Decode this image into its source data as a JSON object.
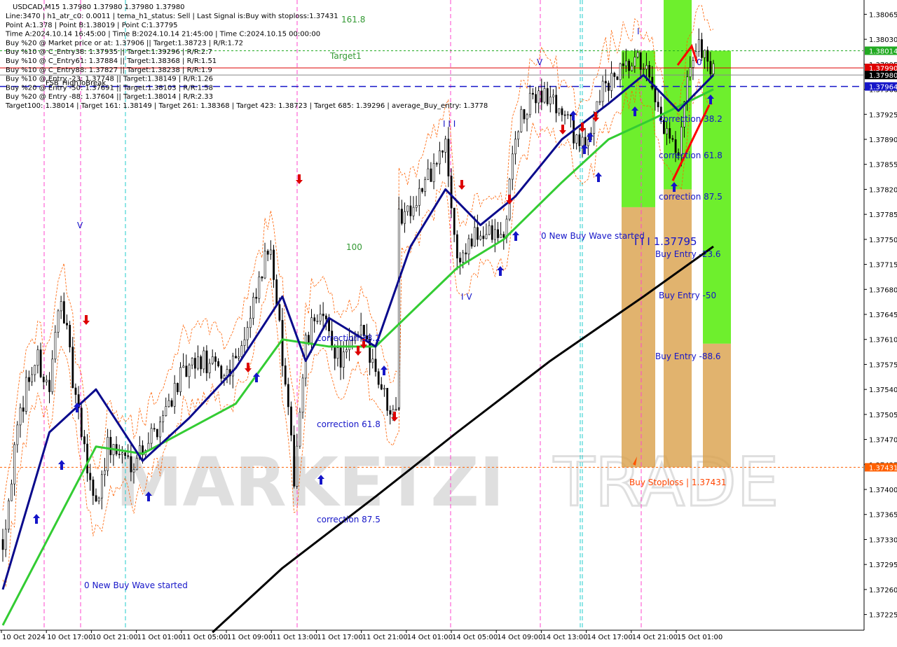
{
  "header": {
    "symbol_line": "USDCAD,M15   1.37980 1.37980 1.37980 1.37980",
    "lines": [
      "Line:3470 | h1_atr_c0: 0.0011 | tema_h1_status: Sell | Last Signal is:Buy with stoploss:1.37431",
      "Point A:1.378 | Point B:1.38019 | Point C:1.37795",
      "Time A:2024.10.14 16:45:00 | Time B:2024.10.14 21:45:00 | Time C:2024.10.15 00:00:00",
      "Buy %20 @ Market price or at: 1.37906 || Target:1.38723 | R/R:1.72",
      "Buy %10 @ C_Entry38: 1.37935 || Target:1.39296 | R/R:2.7",
      "Buy %10 @ C_Entry61: 1.37884 || Target:1.38368 | R/R:1.51",
      "Buy %10 @ C_Entry88: 1.37827 || Target:1.38238 | R/R:1.9",
      "Buy %10 @ Entry -23: 1.37748 || Target:1.38149 | R/R:1.26",
      "Buy %20 @ Entry -50: 1.37691 || Target:1.38103 | R/R:1.58",
      "Buy %20 @ Entry -88: 1.37604 || Target:1.38014 | R/R:2.33",
      "Target100: 1.38014 | Target 161: 1.38149 | Target 261: 1.38368 | Target 423: 1.38723 | Target 685: 1.39296 | average_Buy_entry: 1.3778"
    ]
  },
  "watermark": {
    "text_left": "MARKETZI",
    "text_right": "TRADE"
  },
  "price_axis": {
    "ticks": [
      "1.38065",
      "1.38030",
      "1.37995",
      "1.37960",
      "1.37925",
      "1.37890",
      "1.37855",
      "1.37820",
      "1.37785",
      "1.37750",
      "1.37715",
      "1.37680",
      "1.37645",
      "1.37610",
      "1.37575",
      "1.37540",
      "1.37505",
      "1.37470",
      "1.37435",
      "1.37400",
      "1.37365",
      "1.37330",
      "1.37295",
      "1.37260",
      "1.37225"
    ],
    "badges": [
      {
        "label": "1.38014",
        "value": 1.38014,
        "color": "#22aa22"
      },
      {
        "label": "1.37990",
        "value": 1.3799,
        "color": "#dd0000"
      },
      {
        "label": "1.37980",
        "value": 1.3798,
        "color": "#000000"
      },
      {
        "label": "1.37964",
        "value": 1.37964,
        "color": "#1515c8"
      },
      {
        "label": "1.37431",
        "value": 1.37431,
        "color": "#ff6000"
      }
    ]
  },
  "time_axis": {
    "labels": [
      "10 Oct 2024",
      "10 Oct 17:00",
      "10 Oct 21:00",
      "11 Oct 01:00",
      "11 Oct 05:00",
      "11 Oct 09:00",
      "11 Oct 13:00",
      "11 Oct 17:00",
      "11 Oct 21:00",
      "14 Oct 01:00",
      "14 Oct 05:00",
      "14 Oct 09:00",
      "14 Oct 13:00",
      "14 Oct 17:00",
      "14 Oct 21:00",
      "15 Oct 01:00"
    ]
  },
  "annotations": {
    "level_161": "161.8",
    "level_100": "100",
    "target1": "Target1",
    "fsb_high": "FSB_HighToBreak",
    "correction_382_a": "correction 38.2",
    "correction_618_a": "correction 61.8",
    "correction_875_a": "correction 87.5",
    "new_wave_a": "0 New Buy Wave started",
    "new_wave_b": "0 New Buy Wave started",
    "correction_382_b": "correction 38.2",
    "correction_618_b": "correction 61.8",
    "correction_875_b": "correction 87.5",
    "point_c_label": "I I I 1.37795",
    "buy_entry_236": "Buy Entry -23.6",
    "buy_entry_50": "Buy Entry -50",
    "buy_entry_886": "Buy Entry -88.6",
    "buy_stoploss": "Buy Stoploss | 1.37431",
    "wave_iii": "I I I",
    "wave_iv": "I V",
    "wave_v_a": "V",
    "wave_v_b": "V",
    "wave_i": "I",
    "wave_top_label": "0"
  },
  "colors": {
    "price_bars": "#000000",
    "ema_fast": "#0a0a8c",
    "ema_mid": "#33cc33",
    "ema_slow": "#000000",
    "bands": "#ff6000",
    "buy_zone": "#66ee22",
    "entry_zone": "#d9a04a",
    "stoploss": "#ff6000",
    "target_line": "#22aa22",
    "signal_up": "#1515c8",
    "signal_down": "#dd0000",
    "session_magenta": "#ff44cc",
    "session_cyan": "#22cccc"
  },
  "chart_data": {
    "type": "candlestick",
    "symbol": "USDCAD",
    "timeframe": "M15",
    "ylim": [
      1.37205,
      1.38085
    ],
    "time_range": [
      "2024-10-10 13:00",
      "2024-10-15 03:00"
    ],
    "horizontal_levels": [
      {
        "name": "Target1",
        "value": 1.38014
      },
      {
        "name": "Entry -23",
        "value": 1.3799
      },
      {
        "name": "Current",
        "value": 1.3798
      },
      {
        "name": "FSB_HighToBreak",
        "value": 1.37964
      },
      {
        "name": "Buy Stoploss",
        "value": 1.37431
      }
    ],
    "price_path": [
      {
        "t": "10 Oct 13:00",
        "close": 1.3733
      },
      {
        "t": "10 Oct 14:00",
        "close": 1.3745
      },
      {
        "t": "10 Oct 15:00",
        "close": 1.3755
      },
      {
        "t": "10 Oct 16:00",
        "close": 1.3758
      },
      {
        "t": "10 Oct 17:00",
        "close": 1.3754
      },
      {
        "t": "10 Oct 18:00",
        "close": 1.3768
      },
      {
        "t": "10 Oct 19:00",
        "close": 1.3755
      },
      {
        "t": "10 Oct 20:00",
        "close": 1.3745
      },
      {
        "t": "10 Oct 21:00",
        "close": 1.3738
      },
      {
        "t": "10 Oct 22:00",
        "close": 1.3746
      },
      {
        "t": "11 Oct 00:00",
        "close": 1.3744
      },
      {
        "t": "11 Oct 02:00",
        "close": 1.3748
      },
      {
        "t": "11 Oct 04:00",
        "close": 1.3755
      },
      {
        "t": "11 Oct 06:00",
        "close": 1.3758
      },
      {
        "t": "11 Oct 08:00",
        "close": 1.3756
      },
      {
        "t": "11 Oct 10:00",
        "close": 1.3762
      },
      {
        "t": "11 Oct 12:00",
        "close": 1.3775
      },
      {
        "t": "11 Oct 13:00",
        "close": 1.3758
      },
      {
        "t": "11 Oct 14:00",
        "close": 1.3742
      },
      {
        "t": "11 Oct 15:00",
        "close": 1.376
      },
      {
        "t": "11 Oct 16:00",
        "close": 1.3765
      },
      {
        "t": "11 Oct 18:00",
        "close": 1.3758
      },
      {
        "t": "11 Oct 20:00",
        "close": 1.3762
      },
      {
        "t": "11 Oct 22:00",
        "close": 1.3752
      },
      {
        "t": "14 Oct 00:00",
        "close": 1.3778
      },
      {
        "t": "14 Oct 02:00",
        "close": 1.3782
      },
      {
        "t": "14 Oct 04:00",
        "close": 1.3788
      },
      {
        "t": "14 Oct 05:00",
        "close": 1.3772
      },
      {
        "t": "14 Oct 07:00",
        "close": 1.3776
      },
      {
        "t": "14 Oct 09:00",
        "close": 1.3775
      },
      {
        "t": "14 Oct 10:00",
        "close": 1.379
      },
      {
        "t": "14 Oct 12:00",
        "close": 1.3796
      },
      {
        "t": "14 Oct 14:00",
        "close": 1.3793
      },
      {
        "t": "14 Oct 16:00",
        "close": 1.3787
      },
      {
        "t": "14 Oct 17:00",
        "close": 1.3795
      },
      {
        "t": "14 Oct 19:00",
        "close": 1.3798
      },
      {
        "t": "14 Oct 21:00",
        "close": 1.38
      },
      {
        "t": "14 Oct 22:00",
        "close": 1.3793
      },
      {
        "t": "15 Oct 00:00",
        "close": 1.3786
      },
      {
        "t": "15 Oct 01:00",
        "close": 1.38
      },
      {
        "t": "15 Oct 02:00",
        "close": 1.3802
      },
      {
        "t": "15 Oct 03:00",
        "close": 1.3798
      }
    ],
    "ema_fast": [
      {
        "t": "10 Oct 13:00",
        "v": 1.3726
      },
      {
        "t": "10 Oct 17:00",
        "v": 1.3748
      },
      {
        "t": "10 Oct 21:00",
        "v": 1.3754
      },
      {
        "t": "11 Oct 01:00",
        "v": 1.3744
      },
      {
        "t": "11 Oct 05:00",
        "v": 1.375
      },
      {
        "t": "11 Oct 09:00",
        "v": 1.3757
      },
      {
        "t": "11 Oct 13:00",
        "v": 1.3767
      },
      {
        "t": "11 Oct 15:00",
        "v": 1.3758
      },
      {
        "t": "11 Oct 17:00",
        "v": 1.3764
      },
      {
        "t": "11 Oct 21:00",
        "v": 1.376
      },
      {
        "t": "14 Oct 01:00",
        "v": 1.3774
      },
      {
        "t": "14 Oct 04:00",
        "v": 1.3782
      },
      {
        "t": "14 Oct 07:00",
        "v": 1.3777
      },
      {
        "t": "14 Oct 10:00",
        "v": 1.3781
      },
      {
        "t": "14 Oct 14:00",
        "v": 1.3789
      },
      {
        "t": "14 Oct 18:00",
        "v": 1.3794
      },
      {
        "t": "14 Oct 21:00",
        "v": 1.3798
      },
      {
        "t": "15 Oct 00:00",
        "v": 1.3793
      },
      {
        "t": "15 Oct 03:00",
        "v": 1.3798
      }
    ],
    "ema_mid": [
      {
        "t": "10 Oct 13:00",
        "v": 1.3721
      },
      {
        "t": "10 Oct 21:00",
        "v": 1.3746
      },
      {
        "t": "11 Oct 01:00",
        "v": 1.3745
      },
      {
        "t": "11 Oct 09:00",
        "v": 1.3752
      },
      {
        "t": "11 Oct 13:00",
        "v": 1.3761
      },
      {
        "t": "11 Oct 17:00",
        "v": 1.376
      },
      {
        "t": "11 Oct 21:00",
        "v": 1.376
      },
      {
        "t": "14 Oct 05:00",
        "v": 1.3771
      },
      {
        "t": "14 Oct 09:00",
        "v": 1.3775
      },
      {
        "t": "14 Oct 14:00",
        "v": 1.3783
      },
      {
        "t": "14 Oct 18:00",
        "v": 1.3789
      },
      {
        "t": "14 Oct 22:00",
        "v": 1.3792
      },
      {
        "t": "15 Oct 03:00",
        "v": 1.3796
      }
    ],
    "ema_slow": [
      {
        "t": "11 Oct 07:00",
        "v": 1.372
      },
      {
        "t": "11 Oct 13:00",
        "v": 1.3729
      },
      {
        "t": "11 Oct 21:00",
        "v": 1.3739
      },
      {
        "t": "14 Oct 05:00",
        "v": 1.3748
      },
      {
        "t": "14 Oct 13:00",
        "v": 1.3758
      },
      {
        "t": "14 Oct 21:00",
        "v": 1.3767
      },
      {
        "t": "15 Oct 03:00",
        "v": 1.3774
      }
    ]
  }
}
